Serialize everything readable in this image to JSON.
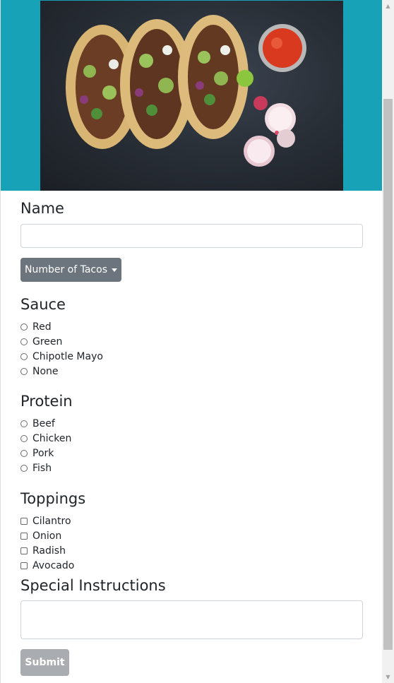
{
  "hero": {
    "image": "tacos-photo",
    "accent_color": "#17a2b8"
  },
  "form": {
    "name_label": "Name",
    "name_value": "",
    "tacos_dropdown_label": "Number of Tacos",
    "sauce": {
      "title": "Sauce",
      "options": [
        "Red",
        "Green",
        "Chipotle Mayo",
        "None"
      ]
    },
    "protein": {
      "title": "Protein",
      "options": [
        "Beef",
        "Chicken",
        "Pork",
        "Fish"
      ]
    },
    "toppings": {
      "title": "Toppings",
      "options": [
        "Cilantro",
        "Onion",
        "Radish",
        "Avocado"
      ]
    },
    "instructions_label": "Special Instructions",
    "instructions_value": "",
    "submit_label": "Submit"
  },
  "colors": {
    "dropdown_bg": "#6c757d",
    "submit_bg": "#a9adb1"
  }
}
